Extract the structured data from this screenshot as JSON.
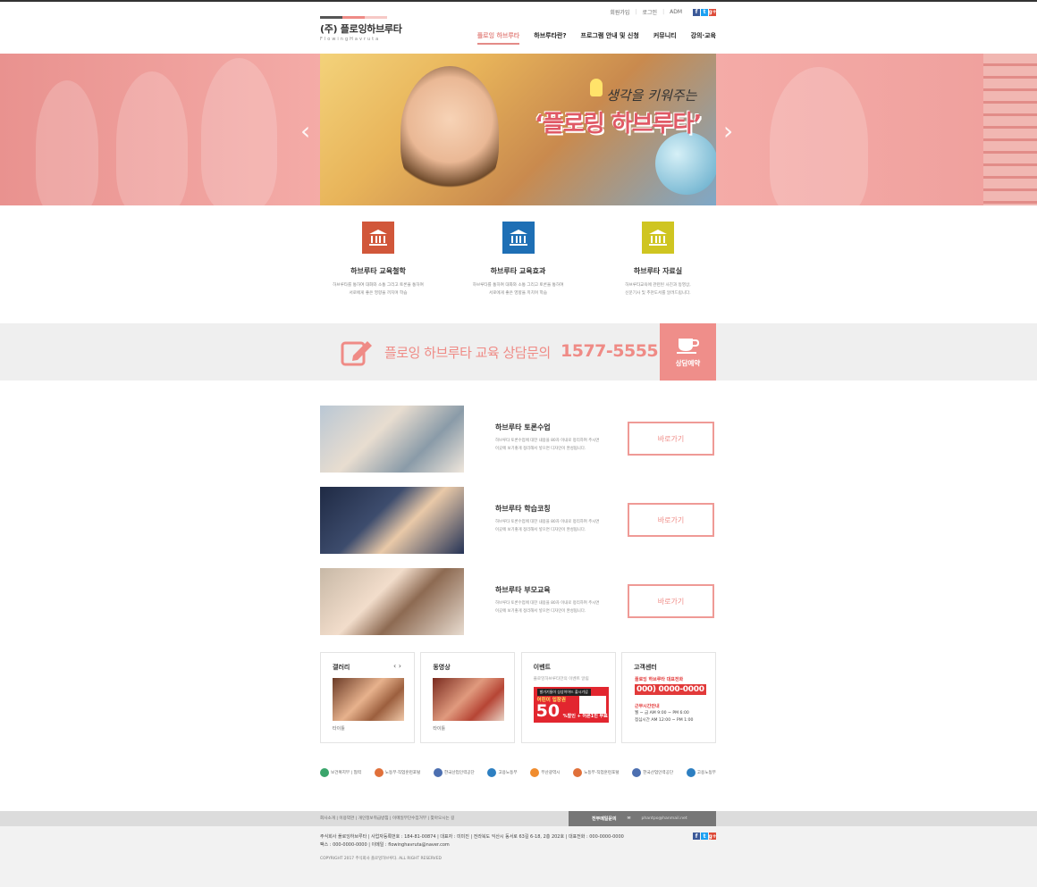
{
  "colors": {
    "accent": "#ef8b86",
    "facebook": "#3b5998",
    "twitter": "#1da1f2",
    "google": "#dd4b39",
    "feature1": "#d1573a",
    "feature2": "#1e6fb5",
    "feature3": "#cfc521",
    "hero_tint": "#f2a5a2"
  },
  "header": {
    "logo_name": "(주) 플로잉하브루타",
    "logo_eng": "FlowingHavruta",
    "util_links": [
      "회원가입",
      "로그인",
      "ADM"
    ],
    "sns": [
      "f",
      "t",
      "g+"
    ],
    "nav": [
      "플로잉 하브루타",
      "하브루타란?",
      "프로그램 안내 및 신청",
      "커뮤니티",
      "강의·교육"
    ],
    "active_nav": "플로잉 하브루타"
  },
  "hero": {
    "subtitle": "생각을 키워주는",
    "title": "‘플로링 하브루타’",
    "prev_icon": "chevron-left-icon",
    "next_icon": "chevron-right-icon"
  },
  "features": [
    {
      "title": "하브루타 교육철학",
      "desc1": "하브루타를 통하여 대화와 소통 그리고 토론을 통하여",
      "desc2": "서로에게 좋은 영향을 끼치며 학습",
      "icon": "institution-icon"
    },
    {
      "title": "하브루타 교육효과",
      "desc1": "하브루타를 통하여 대화와 소통 그리고 토론을 통하여",
      "desc2": "서로에게 좋은 영향을 끼치며 학습",
      "icon": "institution-icon"
    },
    {
      "title": "하브루타 자료실",
      "desc1": "하브루타교육에 관련된 사진과 동영상,",
      "desc2": "신문기사 및 추천도서를 알려드립니다.",
      "icon": "institution-icon"
    }
  ],
  "consult": {
    "text": "플로잉 하브루타 교육 상담문의",
    "phone": "1577-5555",
    "button": "상담예약"
  },
  "programs": [
    {
      "title": "하브루타 토론수업",
      "desc1": "하브루타 토론수업에 대한 내용을 80자 이내로 정리하여 주시면",
      "desc2": "이곳에 보기좋게 정리해서 넣으면 디자인이 완성됩니다.",
      "button": "바로가기"
    },
    {
      "title": "하브루타 학습코칭",
      "desc1": "하브루타 토론수업에 대한 내용을 80자 이내로 정리하여 주시면",
      "desc2": "이곳에 보기좋게 정리해서 넣으면 디자인이 완성됩니다.",
      "button": "바로가기"
    },
    {
      "title": "하브루타 부모교육",
      "desc1": "하브루타 토론수업에 대한 내용을 80자 이내로 정리하여 주시면",
      "desc2": "이곳에 보기좋게 정리해서 넣으면 디자인이 완성됩니다.",
      "button": "바로가기"
    }
  ],
  "boxes": {
    "gallery": {
      "title": "갤러리",
      "nav": "‹ ›",
      "caption": "타이틀"
    },
    "video": {
      "title": "동영상",
      "caption": "타이틀"
    },
    "event": {
      "title": "이벤트",
      "sub": "플로잉하브루타만의 이벤트 알림",
      "banner_top": "발가기들이 상상이어드 출시기념",
      "banner_mid": "어린이 입장권",
      "banner_big": "50",
      "banner_bottom": "%할인 + 어른1인 무료"
    },
    "cs": {
      "title": "고객센터",
      "label": "플로잉 하브루타 대표전화",
      "phone": "000) 0000-0000",
      "hours_title": "근무시간안내",
      "hours1": "월 ~ 금    AM  9:00 ~ PM  6:00",
      "hours2": "점심시간    AM 12:00 ~ PM  1:00"
    }
  },
  "partners": [
    "보건복지부 | 협력",
    "노동부·직업훈련포털",
    "한국산업인력공단",
    "고용노동부",
    "부산광역시",
    "노동부·직업훈련포털",
    "한국산업인력공단",
    "고용노동부"
  ],
  "footer": {
    "links": "회사소개  |  이용약관  |  개인정보취급방침  |  이메일무단수집거부  |  찾아오시는 길",
    "mail_label": "전부메일문의",
    "mail_addr": "phantpo@hanmail.net",
    "line1": "주식회사 플로잉하브루타   |   사업자등록번호 : 184-81-00874   |   대표자 : 미미진   |   전라북도 익산시 동서로 63길 6-18, 2층 202호   |   대표전화 : 000-0000-0000",
    "line2": "팩스 : 000-0000-0000   |   이메일 : flowinghavruta@naver.com",
    "copyright": "COPYRIGHT 2017  주식회사 플로잉하브루타. ALL RIGHT RESERVED"
  }
}
